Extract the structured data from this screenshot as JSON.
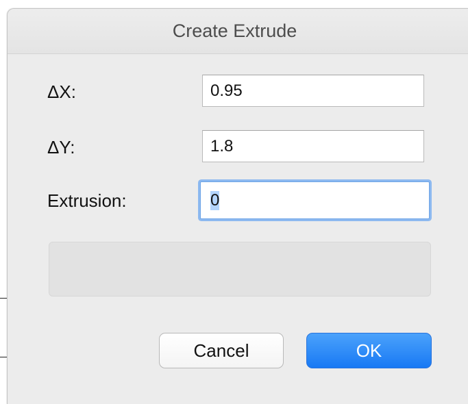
{
  "dialog": {
    "title": "Create Extrude",
    "fields": [
      {
        "label": "ΔX:",
        "value": "0.95"
      },
      {
        "label": "ΔY:",
        "value": "1.8"
      },
      {
        "label": "Extrusion:",
        "value": "0"
      }
    ],
    "cancel_label": "Cancel",
    "ok_label": "OK"
  },
  "colors": {
    "primary_button": "#1a7cf5",
    "focus_ring": "#8db9f0",
    "dialog_background": "#ececec"
  }
}
